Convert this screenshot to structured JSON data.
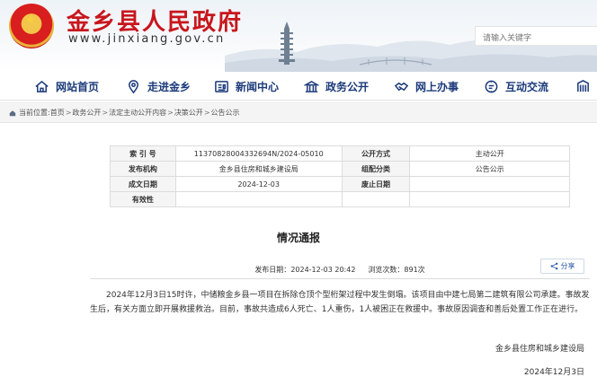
{
  "header": {
    "site_title": "金乡县人民政府",
    "site_url": "www.jinxiang.gov.cn",
    "search_placeholder": "请输入关键字",
    "brand_color": "#c8161d"
  },
  "nav": {
    "items": [
      {
        "label": "网站首页",
        "icon": "home-icon"
      },
      {
        "label": "走进金乡",
        "icon": "location-icon"
      },
      {
        "label": "新闻中心",
        "icon": "news-icon"
      },
      {
        "label": "政务公开",
        "icon": "government-building-icon"
      },
      {
        "label": "网上办事",
        "icon": "handshake-icon"
      },
      {
        "label": "互动交流",
        "icon": "interaction-icon"
      }
    ],
    "text_color": "#1b3a7a"
  },
  "breadcrumb": {
    "prefix": "当前位置:",
    "items": [
      "首页",
      "政务公开",
      "法定主动公开内容",
      "决策公开",
      "公告公示"
    ]
  },
  "info_table": {
    "rows": [
      {
        "k1": "索 引 号",
        "v1": "11370828004332694N/2024-05010",
        "k2": "公开方式",
        "v2": "主动公开"
      },
      {
        "k1": "发布机构",
        "v1": "金乡县住房和城乡建设局",
        "k2": "组配分类",
        "v2": "公告公示"
      },
      {
        "k1": "成文日期",
        "v1": "2024-12-03",
        "k2": "废止日期",
        "v2": ""
      },
      {
        "k1": "有效性",
        "v1": "",
        "k2": "",
        "v2": ""
      }
    ]
  },
  "article": {
    "title": "情况通报",
    "publish_label": "发布日期：",
    "publish_value": "2024-12-03 20:42",
    "views_label": "浏览次数：",
    "views_value": "891次",
    "share_label": "分享",
    "body": "2024年12月3日15时许，中储粮金乡县一项目在拆除仓顶个型桁架过程中发生倒塌。该项目由中建七局第二建筑有限公司承建。事故发生后，有关方面立即开展救援救治。目前，事故共造成6人死亡、1人重伤，1人被困正在救援中。事故原因调查和善后处置工作正在进行。",
    "signature": "金乡县住房和城乡建设局",
    "date": "2024年12月3日"
  }
}
